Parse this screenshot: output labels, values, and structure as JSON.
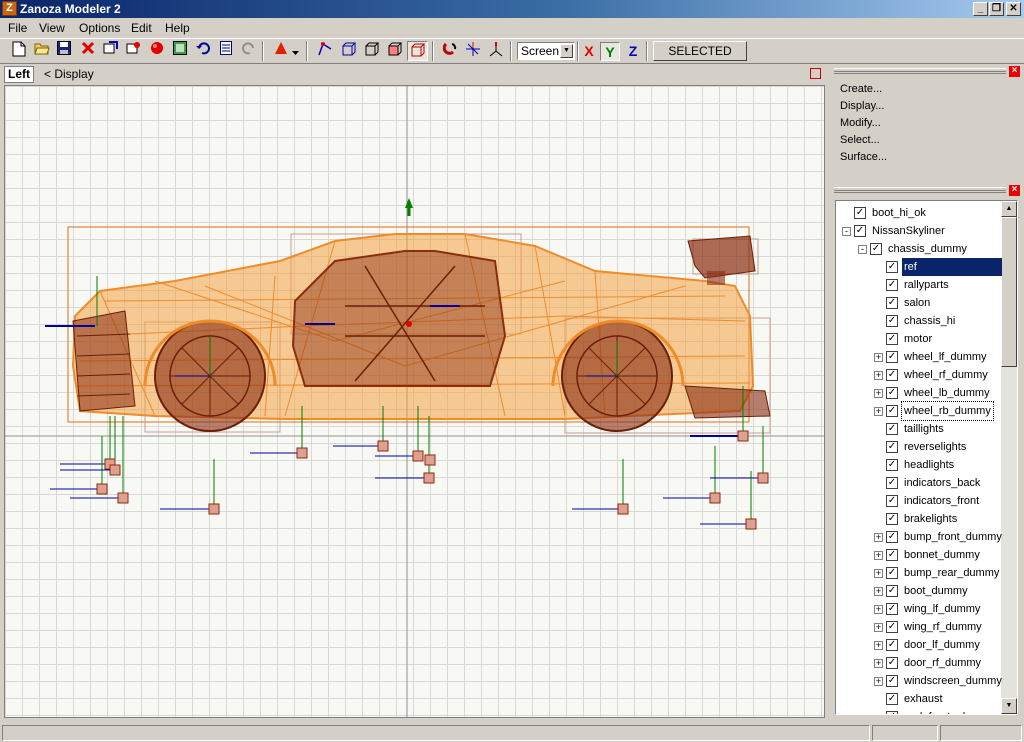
{
  "window": {
    "title": "Zanoza Modeler 2",
    "app_icon_letter": "Z",
    "minimize": "_",
    "restore": "❐",
    "close": "✕"
  },
  "menu": [
    "File",
    "View",
    "Options",
    "Edit",
    "Help"
  ],
  "toolbar": {
    "coord_mode": "Screen",
    "axis_x": "X",
    "axis_y": "Y",
    "axis_z": "Z",
    "selected_label": "SELECTED",
    "icons": [
      "new-icon",
      "open-icon",
      "save-icon",
      "delete-icon",
      "import-icon",
      "merge-icon",
      "material-ball-icon",
      "texture-icon",
      "undo-icon",
      "notes-icon",
      "redo-icon",
      "cone-primitive-icon",
      "select-vertex-icon",
      "box-select-icon",
      "cube-icon",
      "cube-face-icon",
      "cube-edge-icon",
      "magnet-icon",
      "move-axes-icon",
      "rotate-axes-icon"
    ]
  },
  "viewport": {
    "view_name": "Left",
    "display_label": "< Display"
  },
  "command_panel": {
    "items": [
      "Create...",
      "Display...",
      "Modify...",
      "Select...",
      "Surface..."
    ]
  },
  "tree": {
    "items": [
      {
        "label": "boot_hi_ok",
        "level": 0,
        "expander": "",
        "checked": true
      },
      {
        "label": "NissanSkyliner",
        "level": 0,
        "expander": "-",
        "checked": true
      },
      {
        "label": "chassis_dummy",
        "level": 1,
        "expander": "-",
        "checked": true
      },
      {
        "label": "ref",
        "level": 2,
        "expander": "",
        "checked": true,
        "selected": true
      },
      {
        "label": "rallyparts",
        "level": 2,
        "expander": "",
        "checked": true
      },
      {
        "label": "salon",
        "level": 2,
        "expander": "",
        "checked": true
      },
      {
        "label": "chassis_hi",
        "level": 2,
        "expander": "",
        "checked": true
      },
      {
        "label": "motor",
        "level": 2,
        "expander": "",
        "checked": true
      },
      {
        "label": "wheel_lf_dummy",
        "level": 2,
        "expander": "+",
        "checked": true
      },
      {
        "label": "wheel_rf_dummy",
        "level": 2,
        "expander": "+",
        "checked": true
      },
      {
        "label": "wheel_lb_dummy",
        "level": 2,
        "expander": "+",
        "checked": true
      },
      {
        "label": "wheel_rb_dummy",
        "level": 2,
        "expander": "+",
        "checked": true,
        "focused": true
      },
      {
        "label": "taillights",
        "level": 2,
        "expander": "",
        "checked": true
      },
      {
        "label": "reverselights",
        "level": 2,
        "expander": "",
        "checked": true
      },
      {
        "label": "headlights",
        "level": 2,
        "expander": "",
        "checked": true
      },
      {
        "label": "indicators_back",
        "level": 2,
        "expander": "",
        "checked": true
      },
      {
        "label": "indicators_front",
        "level": 2,
        "expander": "",
        "checked": true
      },
      {
        "label": "brakelights",
        "level": 2,
        "expander": "",
        "checked": true
      },
      {
        "label": "bump_front_dummy",
        "level": 2,
        "expander": "+",
        "checked": true
      },
      {
        "label": "bonnet_dummy",
        "level": 2,
        "expander": "+",
        "checked": true
      },
      {
        "label": "bump_rear_dummy",
        "level": 2,
        "expander": "+",
        "checked": true
      },
      {
        "label": "boot_dummy",
        "level": 2,
        "expander": "+",
        "checked": true
      },
      {
        "label": "wing_lf_dummy",
        "level": 2,
        "expander": "+",
        "checked": true
      },
      {
        "label": "wing_rf_dummy",
        "level": 2,
        "expander": "+",
        "checked": true
      },
      {
        "label": "door_lf_dummy",
        "level": 2,
        "expander": "+",
        "checked": true
      },
      {
        "label": "door_rf_dummy",
        "level": 2,
        "expander": "+",
        "checked": true
      },
      {
        "label": "windscreen_dummy",
        "level": 2,
        "expander": "+",
        "checked": true
      },
      {
        "label": "exhaust",
        "level": 2,
        "expander": "",
        "checked": true
      },
      {
        "label": "ped_frontpnl",
        "level": 2,
        "expander": "",
        "checked": true
      }
    ]
  },
  "colors": {
    "wireframe_orange": "#f08c28",
    "wireframe_brown": "#8a2d10",
    "selection_blue": "#0a246a"
  }
}
